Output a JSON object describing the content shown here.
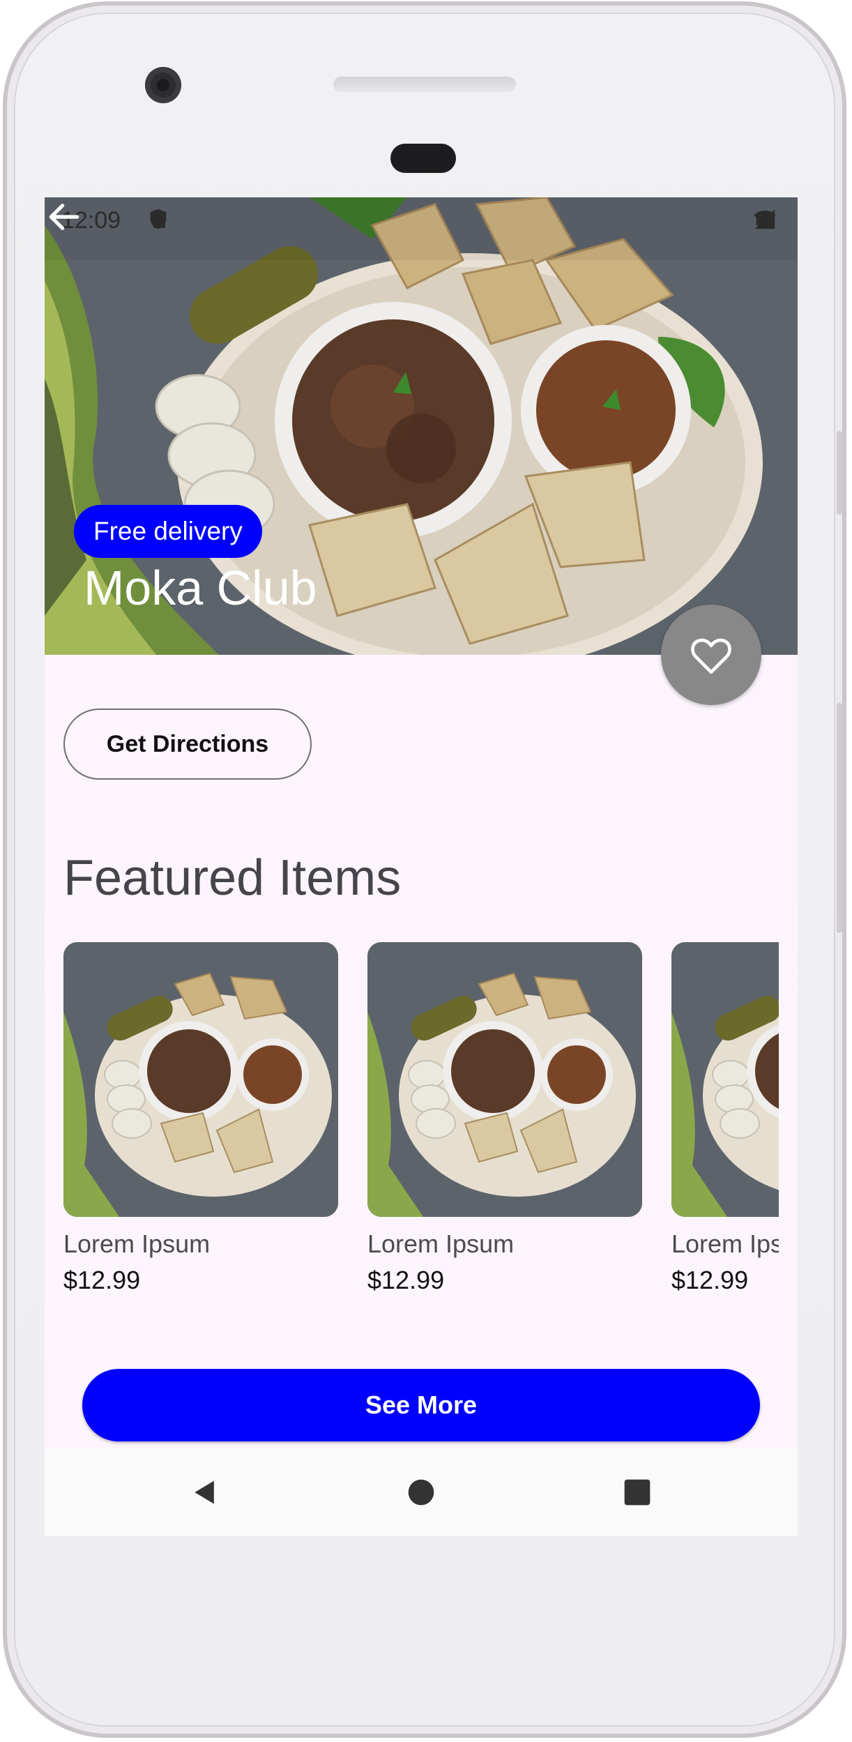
{
  "status": {
    "time": "12:09"
  },
  "restaurant": {
    "name": "Moka Club",
    "badge": "Free delivery"
  },
  "actions": {
    "directions_label": "Get Directions",
    "see_more_label": "See More"
  },
  "featured": {
    "title": "Featured Items",
    "items": [
      {
        "name": "Lorem Ipsum",
        "price": "$12.99"
      },
      {
        "name": "Lorem Ipsum",
        "price": "$12.99"
      },
      {
        "name": "Lorem Ipsum",
        "price": "$12.99"
      }
    ]
  },
  "colors": {
    "accent": "#0000ff",
    "background": "#fcf5fd",
    "fab": "#888888"
  },
  "icons": [
    "back-arrow-icon",
    "heart-outline-icon",
    "settings-icon",
    "shield-icon",
    "sim-card-icon",
    "wifi-icon",
    "signal-icon",
    "battery-icon",
    "nav-back-icon",
    "nav-home-icon",
    "nav-recents-icon"
  ]
}
